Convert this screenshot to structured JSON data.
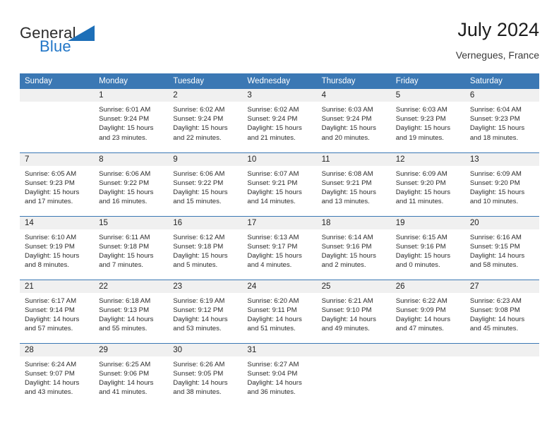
{
  "logo": {
    "word1": "General",
    "word2": "Blue",
    "triangle_color": "#1d6fb8",
    "text_color": "#2b2b2b",
    "blue_color": "#2176c7"
  },
  "header": {
    "title": "July 2024",
    "subtitle": "Vernegues, France"
  },
  "theme": {
    "header_bar": "#3b78b4",
    "daynum_bg": "#f0f0f0",
    "grid_line": "#3b78b4"
  },
  "weekdays": [
    "Sunday",
    "Monday",
    "Tuesday",
    "Wednesday",
    "Thursday",
    "Friday",
    "Saturday"
  ],
  "weeks": [
    [
      {
        "day": "",
        "sunrise": "",
        "sunset": "",
        "daylight1": "",
        "daylight2": ""
      },
      {
        "day": "1",
        "sunrise": "Sunrise: 6:01 AM",
        "sunset": "Sunset: 9:24 PM",
        "daylight1": "Daylight: 15 hours",
        "daylight2": "and 23 minutes."
      },
      {
        "day": "2",
        "sunrise": "Sunrise: 6:02 AM",
        "sunset": "Sunset: 9:24 PM",
        "daylight1": "Daylight: 15 hours",
        "daylight2": "and 22 minutes."
      },
      {
        "day": "3",
        "sunrise": "Sunrise: 6:02 AM",
        "sunset": "Sunset: 9:24 PM",
        "daylight1": "Daylight: 15 hours",
        "daylight2": "and 21 minutes."
      },
      {
        "day": "4",
        "sunrise": "Sunrise: 6:03 AM",
        "sunset": "Sunset: 9:24 PM",
        "daylight1": "Daylight: 15 hours",
        "daylight2": "and 20 minutes."
      },
      {
        "day": "5",
        "sunrise": "Sunrise: 6:03 AM",
        "sunset": "Sunset: 9:23 PM",
        "daylight1": "Daylight: 15 hours",
        "daylight2": "and 19 minutes."
      },
      {
        "day": "6",
        "sunrise": "Sunrise: 6:04 AM",
        "sunset": "Sunset: 9:23 PM",
        "daylight1": "Daylight: 15 hours",
        "daylight2": "and 18 minutes."
      }
    ],
    [
      {
        "day": "7",
        "sunrise": "Sunrise: 6:05 AM",
        "sunset": "Sunset: 9:23 PM",
        "daylight1": "Daylight: 15 hours",
        "daylight2": "and 17 minutes."
      },
      {
        "day": "8",
        "sunrise": "Sunrise: 6:06 AM",
        "sunset": "Sunset: 9:22 PM",
        "daylight1": "Daylight: 15 hours",
        "daylight2": "and 16 minutes."
      },
      {
        "day": "9",
        "sunrise": "Sunrise: 6:06 AM",
        "sunset": "Sunset: 9:22 PM",
        "daylight1": "Daylight: 15 hours",
        "daylight2": "and 15 minutes."
      },
      {
        "day": "10",
        "sunrise": "Sunrise: 6:07 AM",
        "sunset": "Sunset: 9:21 PM",
        "daylight1": "Daylight: 15 hours",
        "daylight2": "and 14 minutes."
      },
      {
        "day": "11",
        "sunrise": "Sunrise: 6:08 AM",
        "sunset": "Sunset: 9:21 PM",
        "daylight1": "Daylight: 15 hours",
        "daylight2": "and 13 minutes."
      },
      {
        "day": "12",
        "sunrise": "Sunrise: 6:09 AM",
        "sunset": "Sunset: 9:20 PM",
        "daylight1": "Daylight: 15 hours",
        "daylight2": "and 11 minutes."
      },
      {
        "day": "13",
        "sunrise": "Sunrise: 6:09 AM",
        "sunset": "Sunset: 9:20 PM",
        "daylight1": "Daylight: 15 hours",
        "daylight2": "and 10 minutes."
      }
    ],
    [
      {
        "day": "14",
        "sunrise": "Sunrise: 6:10 AM",
        "sunset": "Sunset: 9:19 PM",
        "daylight1": "Daylight: 15 hours",
        "daylight2": "and 8 minutes."
      },
      {
        "day": "15",
        "sunrise": "Sunrise: 6:11 AM",
        "sunset": "Sunset: 9:18 PM",
        "daylight1": "Daylight: 15 hours",
        "daylight2": "and 7 minutes."
      },
      {
        "day": "16",
        "sunrise": "Sunrise: 6:12 AM",
        "sunset": "Sunset: 9:18 PM",
        "daylight1": "Daylight: 15 hours",
        "daylight2": "and 5 minutes."
      },
      {
        "day": "17",
        "sunrise": "Sunrise: 6:13 AM",
        "sunset": "Sunset: 9:17 PM",
        "daylight1": "Daylight: 15 hours",
        "daylight2": "and 4 minutes."
      },
      {
        "day": "18",
        "sunrise": "Sunrise: 6:14 AM",
        "sunset": "Sunset: 9:16 PM",
        "daylight1": "Daylight: 15 hours",
        "daylight2": "and 2 minutes."
      },
      {
        "day": "19",
        "sunrise": "Sunrise: 6:15 AM",
        "sunset": "Sunset: 9:16 PM",
        "daylight1": "Daylight: 15 hours",
        "daylight2": "and 0 minutes."
      },
      {
        "day": "20",
        "sunrise": "Sunrise: 6:16 AM",
        "sunset": "Sunset: 9:15 PM",
        "daylight1": "Daylight: 14 hours",
        "daylight2": "and 58 minutes."
      }
    ],
    [
      {
        "day": "21",
        "sunrise": "Sunrise: 6:17 AM",
        "sunset": "Sunset: 9:14 PM",
        "daylight1": "Daylight: 14 hours",
        "daylight2": "and 57 minutes."
      },
      {
        "day": "22",
        "sunrise": "Sunrise: 6:18 AM",
        "sunset": "Sunset: 9:13 PM",
        "daylight1": "Daylight: 14 hours",
        "daylight2": "and 55 minutes."
      },
      {
        "day": "23",
        "sunrise": "Sunrise: 6:19 AM",
        "sunset": "Sunset: 9:12 PM",
        "daylight1": "Daylight: 14 hours",
        "daylight2": "and 53 minutes."
      },
      {
        "day": "24",
        "sunrise": "Sunrise: 6:20 AM",
        "sunset": "Sunset: 9:11 PM",
        "daylight1": "Daylight: 14 hours",
        "daylight2": "and 51 minutes."
      },
      {
        "day": "25",
        "sunrise": "Sunrise: 6:21 AM",
        "sunset": "Sunset: 9:10 PM",
        "daylight1": "Daylight: 14 hours",
        "daylight2": "and 49 minutes."
      },
      {
        "day": "26",
        "sunrise": "Sunrise: 6:22 AM",
        "sunset": "Sunset: 9:09 PM",
        "daylight1": "Daylight: 14 hours",
        "daylight2": "and 47 minutes."
      },
      {
        "day": "27",
        "sunrise": "Sunrise: 6:23 AM",
        "sunset": "Sunset: 9:08 PM",
        "daylight1": "Daylight: 14 hours",
        "daylight2": "and 45 minutes."
      }
    ],
    [
      {
        "day": "28",
        "sunrise": "Sunrise: 6:24 AM",
        "sunset": "Sunset: 9:07 PM",
        "daylight1": "Daylight: 14 hours",
        "daylight2": "and 43 minutes."
      },
      {
        "day": "29",
        "sunrise": "Sunrise: 6:25 AM",
        "sunset": "Sunset: 9:06 PM",
        "daylight1": "Daylight: 14 hours",
        "daylight2": "and 41 minutes."
      },
      {
        "day": "30",
        "sunrise": "Sunrise: 6:26 AM",
        "sunset": "Sunset: 9:05 PM",
        "daylight1": "Daylight: 14 hours",
        "daylight2": "and 38 minutes."
      },
      {
        "day": "31",
        "sunrise": "Sunrise: 6:27 AM",
        "sunset": "Sunset: 9:04 PM",
        "daylight1": "Daylight: 14 hours",
        "daylight2": "and 36 minutes."
      },
      {
        "day": "",
        "sunrise": "",
        "sunset": "",
        "daylight1": "",
        "daylight2": ""
      },
      {
        "day": "",
        "sunrise": "",
        "sunset": "",
        "daylight1": "",
        "daylight2": ""
      },
      {
        "day": "",
        "sunrise": "",
        "sunset": "",
        "daylight1": "",
        "daylight2": ""
      }
    ]
  ]
}
